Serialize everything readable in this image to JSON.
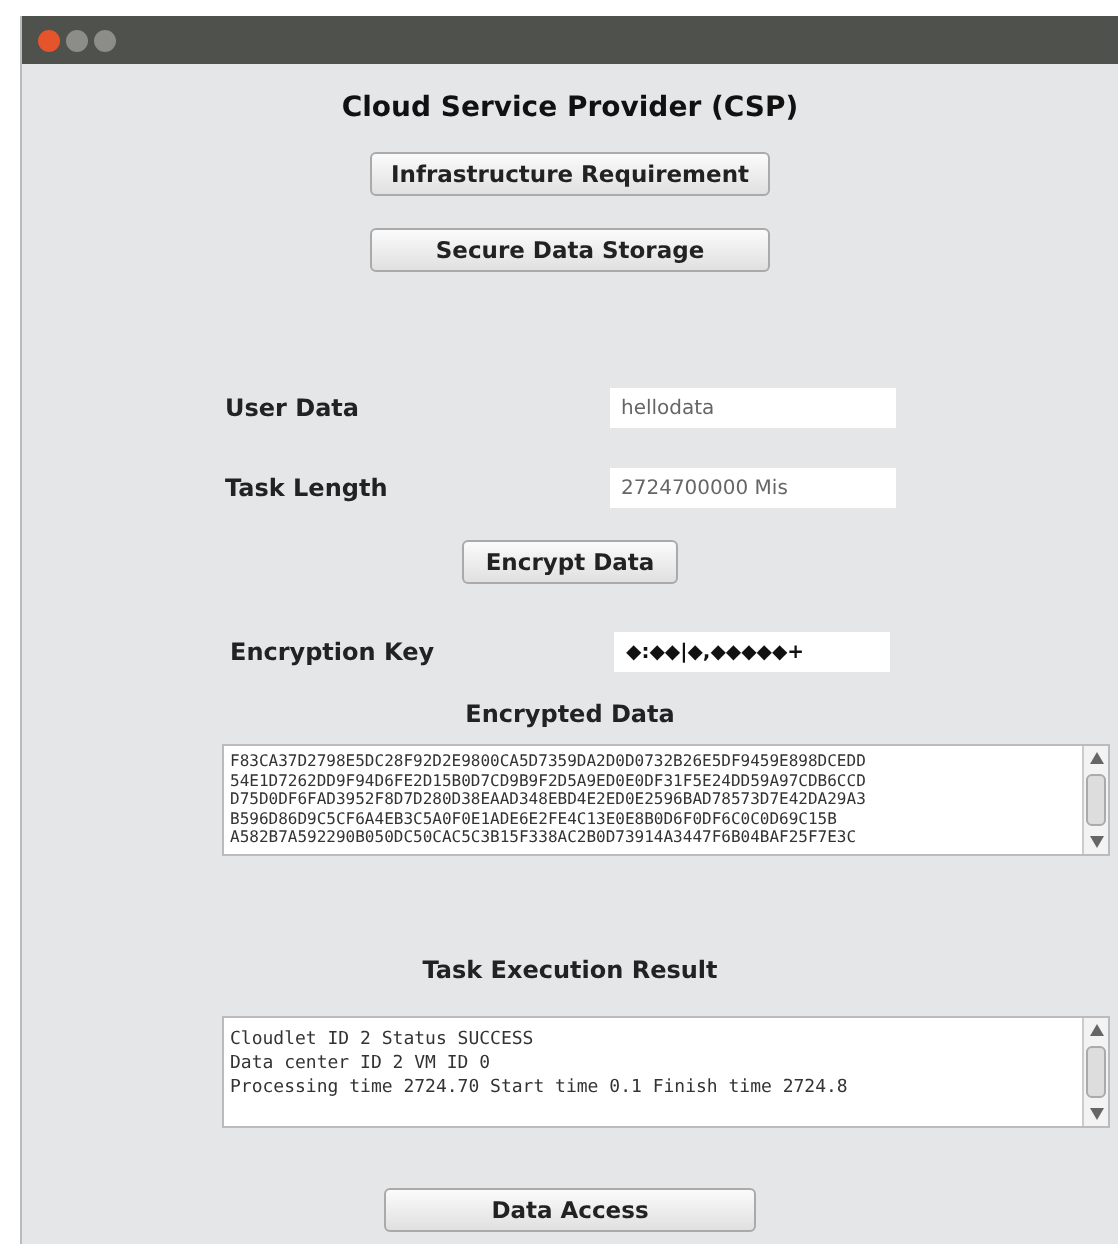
{
  "window": {
    "title": "Cloud Service Provider (CSP)"
  },
  "top_buttons": [
    "Infrastructure Requirement",
    "Secure Data Storage"
  ],
  "fields": [
    {
      "label": "User Data",
      "value": "hellodata"
    },
    {
      "label": "Task Length",
      "value": "2724700000 Mis"
    }
  ],
  "encrypt_button": "Encrypt Data",
  "key_field": {
    "label": "Encryption Key",
    "value": "◆:◆◆|◆,◆◆◆◆◆+"
  },
  "encrypted": {
    "label": "Encrypted Data",
    "lines": [
      "F83CA37D2798E5DC28F92D2E9800CA5D7359DA2D0D0732B26E5DF9459E898DCEDD",
      "54E1D7262DD9F94D6FE2D15B0D7CD9B9F2D5A9ED0E0DF31F5E24DD59A97CDB6CCD",
      "D75D0DF6FAD3952F8D7D280D38EAAD348EBD4E2ED0E2596BAD78573D7E42DA29A3",
      "B596D86D9C5CF6A4EB3C5A0F0E1ADE6E2FE4C13E0E8B0D6F0DF6C0C0D69C15B",
      "A582B7A592290B050DC50CAC5C3B15F338AC2B0D73914A3447F6B04BAF25F7E3C"
    ]
  },
  "result": {
    "label": "Task Execution Result",
    "lines": [
      "Cloudlet ID 2 Status SUCCESS",
      "Data center ID 2 VM ID 0",
      "Processing time 2724.70 Start time 0.1 Finish time 2724.8"
    ]
  },
  "bottom_button": "Data Access"
}
